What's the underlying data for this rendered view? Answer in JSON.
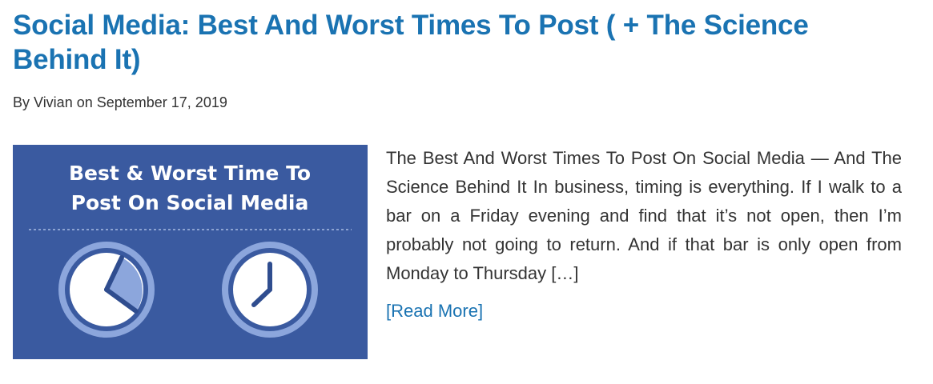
{
  "post": {
    "title": "Social Media: Best And Worst Times To Post ( + The Science Behind It)",
    "byline": "By Vivian on September 17, 2019",
    "excerpt": "The Best And Worst Times To Post On Social Media — And The Science Behind It In business, timing is everything. If I walk to a bar on a Friday evening and find that it’s not open, then I’m probably not going to return. And if that bar is only open from Monday to Thursday […]",
    "read_more": "[Read More]"
  },
  "thumbnail": {
    "line1": "Best & Worst Time To",
    "line2": "Post On Social Media",
    "background": "#3a5aa0",
    "accent": "#8ca6dc",
    "icons": [
      "clock-icon",
      "clock-icon"
    ]
  },
  "colors": {
    "title": "#1a73b2",
    "text": "#333333",
    "link": "#1a73b2"
  }
}
